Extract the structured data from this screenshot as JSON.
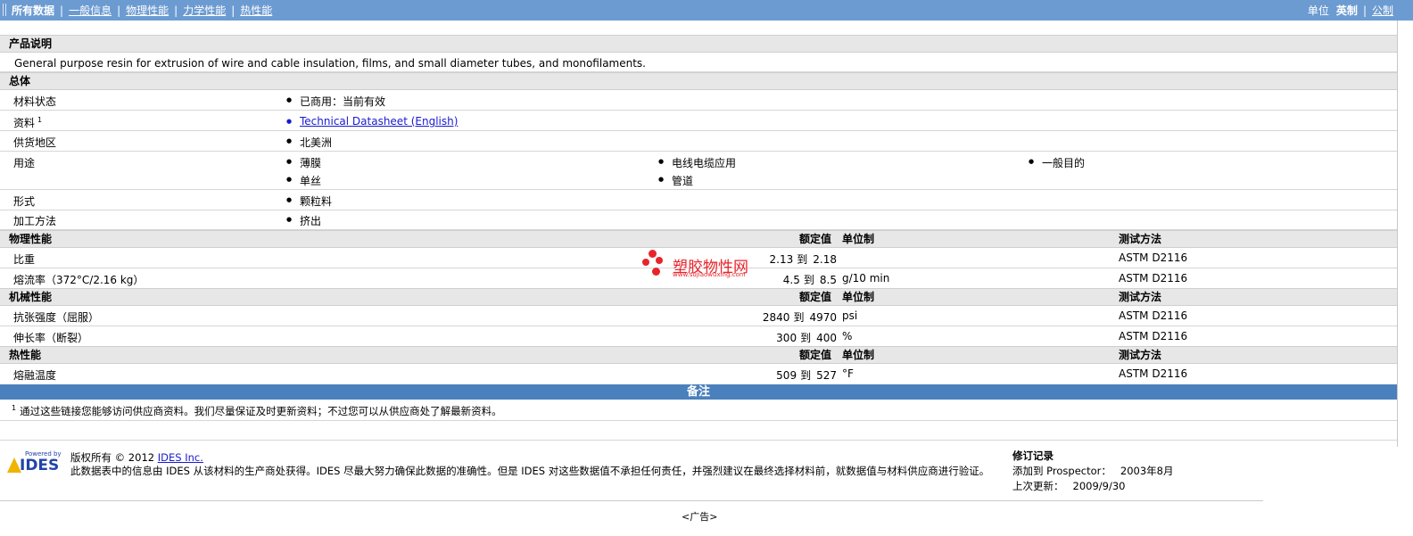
{
  "nav": {
    "tabs": [
      {
        "label": "所有数据",
        "active": true
      },
      {
        "label": "一般信息",
        "active": false
      },
      {
        "label": "物理性能",
        "active": false
      },
      {
        "label": "力学性能",
        "active": false
      },
      {
        "label": "热性能",
        "active": false
      }
    ],
    "separator": "|",
    "units_label": "单位",
    "unit_english": "英制",
    "unit_metric": "公制"
  },
  "product": {
    "header": "产品说明",
    "description": "General purpose resin for extrusion of wire and cable insulation, films, and small diameter tubes, and monofilaments."
  },
  "general": {
    "header": "总体",
    "material_status_label": "材料状态",
    "material_status_value": "已商用：当前有效",
    "docs_label": "资料",
    "docs_sup": "1",
    "docs_link": "Technical Datasheet (English)",
    "region_label": "供货地区",
    "region_value": "北美洲",
    "uses_label": "用途",
    "uses": [
      "薄膜",
      "电线电缆应用",
      "一般目的",
      "单丝",
      "管道"
    ],
    "form_label": "形式",
    "form_value": "颗粒料",
    "process_label": "加工方法",
    "process_value": "挤出"
  },
  "columns": {
    "rated": "额定值",
    "unit": "单位制",
    "test": "测试方法"
  },
  "sections": {
    "physical": {
      "header": "物理性能",
      "rows": [
        {
          "name": "比重",
          "low": "2.13",
          "to": "到",
          "high": "2.18",
          "unit": "",
          "test": "ASTM D2116"
        },
        {
          "name": "熔流率（372°C/2.16 kg）",
          "low": "4.5",
          "to": "到",
          "high": "8.5",
          "unit": "g/10 min",
          "test": "ASTM D2116"
        }
      ]
    },
    "mechanical": {
      "header": "机械性能",
      "rows": [
        {
          "name": "抗张强度（屈服）",
          "low": "2840",
          "to": "到",
          "high": "4970",
          "unit": "psi",
          "test": "ASTM D2116"
        },
        {
          "name": "伸长率（断裂）",
          "low": "300",
          "to": "到",
          "high": "400",
          "unit": "%",
          "test": "ASTM D2116"
        }
      ]
    },
    "thermal": {
      "header": "热性能",
      "rows": [
        {
          "name": "熔融温度",
          "low": "509",
          "to": "到",
          "high": "527",
          "unit": "°F",
          "test": "ASTM D2116"
        }
      ]
    }
  },
  "watermark": {
    "name": "塑胶物性网",
    "url": "www.sujiaowuxing.com"
  },
  "remarks": {
    "header": "备注",
    "note_sup": "1",
    "note": "通过这些链接您能够访问供应商资料。我们尽量保证及时更新资料；不过您可以从供应商处了解最新资料。"
  },
  "footer": {
    "powered_by": "Powered by",
    "logo_text": "IDES",
    "copyright_prefix": "版权所有 © 2012",
    "copyright_link": "IDES Inc.",
    "disclaimer": "此数据表中的信息由 IDES 从该材料的生产商处获得。IDES 尽最大努力确保此数据的准确性。但是 IDES 对这些数据值不承担任何责任，并强烈建议在最终选择材料前，就数据值与材料供应商进行验证。",
    "revision_title": "修订记录",
    "added_label": "添加到 Prospector：",
    "added_value": "2003年8月",
    "updated_label": "上次更新：",
    "updated_value": "2009/9/30",
    "ad": "<广告>"
  },
  "colors": {
    "nav_bg": "#6c9bd2",
    "remarks_bg": "#4a80bc",
    "section_bg": "#e7e7e7",
    "watermark": "#e8242b",
    "link": "#1a1ad0"
  }
}
